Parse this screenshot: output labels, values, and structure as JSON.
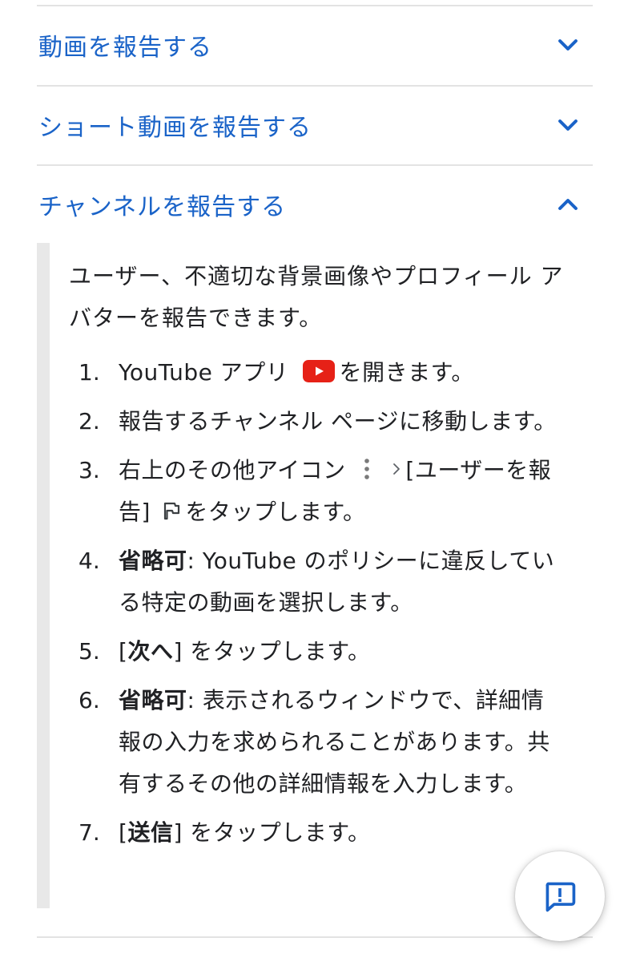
{
  "accordion": {
    "sections": [
      {
        "title": "動画を報告する",
        "expanded": false
      },
      {
        "title": "ショート動画を報告する",
        "expanded": false
      },
      {
        "title": "チャンネルを報告する",
        "expanded": true
      }
    ]
  },
  "channel_report": {
    "intro": "ユーザー、不適切な背景画像やプロフィール アバターを報告できます。",
    "steps": [
      {
        "num": "1.",
        "text_before": "YouTube アプリ",
        "text_after": "を開きます。",
        "icon": "youtube-icon"
      },
      {
        "num": "2.",
        "text": "報告するチャンネル ページに移動します。"
      },
      {
        "num": "3.",
        "text_before": "右上のその他アイコン",
        "text_middle": "[ユーザーを報告]",
        "text_after": "をタップします。",
        "icons": [
          "more-vert-icon",
          "chevron-right-icon",
          "flag-icon"
        ]
      },
      {
        "num": "4.",
        "bold": "省略可",
        "text": ": YouTube のポリシーに違反している特定の動画を選択します。"
      },
      {
        "num": "5.",
        "open": "[",
        "bold": "次へ",
        "text": "] をタップします。"
      },
      {
        "num": "6.",
        "bold": "省略可",
        "text": ": 表示されるウィンドウで、詳細情報の入力を求められることがあります。共有するその他の詳細情報を入力します。"
      },
      {
        "num": "7.",
        "open": "[",
        "bold": "送信",
        "text": "] をタップします。"
      }
    ]
  },
  "fab": {
    "icon": "feedback-icon"
  },
  "colors": {
    "link": "#1a63c8",
    "text": "#202124",
    "divider": "#e3e3e3",
    "youtube_red": "#e62117"
  }
}
